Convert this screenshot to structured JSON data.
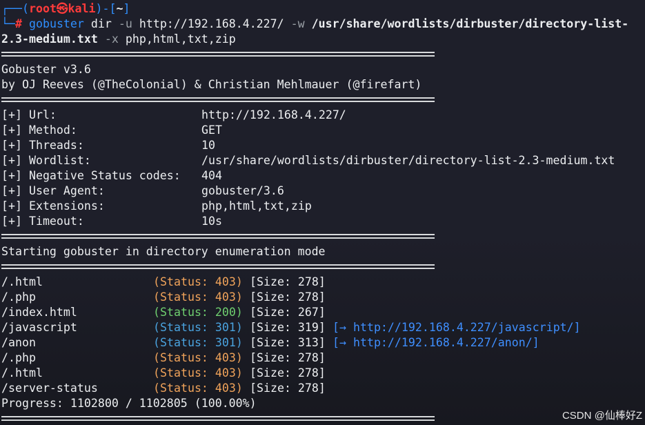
{
  "prompt": {
    "corner_top": "┌──(",
    "user_host": "root㉿kali",
    "mid": ")-[",
    "path": "~",
    "close": "]",
    "corner_bottom": "└─",
    "hash": "#",
    "command": "gobuster",
    "subcmd": " dir ",
    "flag_u": "-u",
    "url": " http://192.168.4.227/ ",
    "flag_w": "-w",
    "wordlist_part1": " /usr/share/wordlists/dirbuster/directory-list-",
    "wordlist_part2": "2.3-medium.txt",
    "flag_x": " -x",
    "extensions": " php,html,txt,zip"
  },
  "banner": {
    "version": "Gobuster v3.6",
    "authors": "by OJ Reeves (@TheColonial) & Christian Mehlmauer (@firefart)"
  },
  "config": [
    {
      "key": "[+] Url:",
      "value": "http://192.168.4.227/"
    },
    {
      "key": "[+] Method:",
      "value": "GET"
    },
    {
      "key": "[+] Threads:",
      "value": "10"
    },
    {
      "key": "[+] Wordlist:",
      "value": "/usr/share/wordlists/dirbuster/directory-list-2.3-medium.txt"
    },
    {
      "key": "[+] Negative Status codes:",
      "value": "404"
    },
    {
      "key": "[+] User Agent:",
      "value": "gobuster/3.6"
    },
    {
      "key": "[+] Extensions:",
      "value": "php,html,txt,zip"
    },
    {
      "key": "[+] Timeout:",
      "value": "10s"
    }
  ],
  "mode_line": "Starting gobuster in directory enumeration mode",
  "results": [
    {
      "path": "/.html",
      "status": "(Status: 403)",
      "size": "[Size: 278]",
      "redirect": ""
    },
    {
      "path": "/.php",
      "status": "(Status: 403)",
      "size": "[Size: 278]",
      "redirect": ""
    },
    {
      "path": "/index.html",
      "status": "(Status: 200)",
      "size": "[Size: 267]",
      "redirect": ""
    },
    {
      "path": "/javascript",
      "status": "(Status: 301)",
      "size": "[Size: 319]",
      "redirect": "[→ http://192.168.4.227/javascript/]"
    },
    {
      "path": "/anon",
      "status": "(Status: 301)",
      "size": "[Size: 313]",
      "redirect": "[→ http://192.168.4.227/anon/]"
    },
    {
      "path": "/.php",
      "status": "(Status: 403)",
      "size": "[Size: 278]",
      "redirect": ""
    },
    {
      "path": "/.html",
      "status": "(Status: 403)",
      "size": "[Size: 278]",
      "redirect": ""
    },
    {
      "path": "/server-status",
      "status": "(Status: 403)",
      "size": "[Size: 278]",
      "redirect": ""
    }
  ],
  "progress": "Progress: 1102800 / 1102805 (100.00%)",
  "watermark": "CSDN @仙棒好Z",
  "colors": {
    "background": "#1e1f2a",
    "prompt_blue": "#2f8fff",
    "prompt_red": "#ff3b3b",
    "status_403": "#f0a35a",
    "status_200": "#6fcf6f",
    "status_301": "#4aa3df",
    "link": "#3f8fff"
  }
}
